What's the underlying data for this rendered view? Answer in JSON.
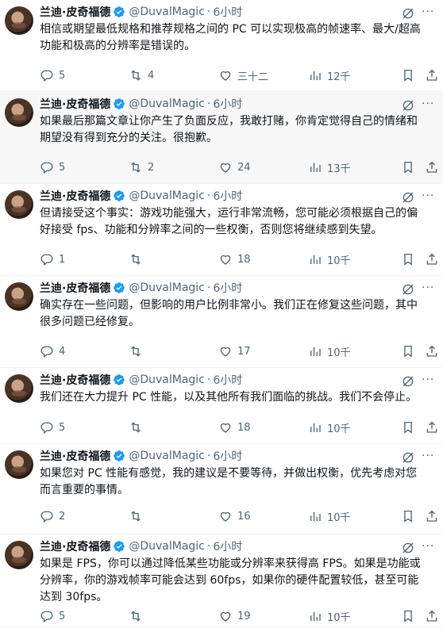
{
  "tweets": [
    {
      "name": "兰迪·皮奇福德",
      "handle": "@DuvalMagic",
      "dot": "·",
      "time": "6小时",
      "text": "相信或期望最低规格和推荐规格之间的 PC 可以实现极高的帧速率、最大/超高\n功能和极高的分辨率是错误的。",
      "replies": "5",
      "retweets": "4",
      "likes": "三十二",
      "views": "12千",
      "highlighted": false
    },
    {
      "name": "兰迪·皮奇福德",
      "handle": "@DuvalMagic",
      "dot": "·",
      "time": "6小时",
      "text": "如果最后那篇文章让你产生了负面反应，我敢打赌，你肯定觉得自己的情绪和\n期望没有得到充分的关注。很抱歉。",
      "replies": "5",
      "retweets": "2",
      "likes": "24",
      "views": "13千",
      "highlighted": true
    },
    {
      "name": "兰迪·皮奇福德",
      "handle": "@DuvalMagic",
      "dot": "·",
      "time": "6小时",
      "text": "但请接受这个事实：游戏功能强大，运行非常流畅，您可能必须根据自己的偏\n好接受 fps、功能和分辨率之间的一些权衡，否则您将继续感到失望。",
      "replies": "1",
      "retweets": "",
      "likes": "18",
      "views": "10千",
      "highlighted": false
    },
    {
      "name": "兰迪·皮奇福德",
      "handle": "@DuvalMagic",
      "dot": "·",
      "time": "6小时",
      "text": "确实存在一些问题，但影响的用户比例非常小。我们正在修复这些问题，其中\n很多问题已经修复。",
      "replies": "4",
      "retweets": "",
      "likes": "17",
      "views": "10千",
      "highlighted": false
    },
    {
      "name": "兰迪·皮奇福德",
      "handle": "@DuvalMagic",
      "dot": "·",
      "time": "6小时",
      "text": "我们还在大力提升 PC 性能，以及其他所有我们面临的挑战。我们不会停止。",
      "replies": "5",
      "retweets": "",
      "likes": "18",
      "views": "10千",
      "highlighted": false
    },
    {
      "name": "兰迪·皮奇福德",
      "handle": "@DuvalMagic",
      "dot": "·",
      "time": "6小时",
      "text": "如果您对 PC 性能有感觉，我的建议是不要等待，并做出权衡，优先考虑对您\n而言重要的事情。",
      "replies": "2",
      "retweets": "",
      "likes": "16",
      "views": "10千",
      "highlighted": false
    },
    {
      "name": "兰迪·皮奇福德",
      "handle": "@DuvalMagic",
      "dot": "·",
      "time": "6小时",
      "text": "如果是 FPS，你可以通过降低某些功能或分辨率来获得高 FPS。如果是功能或\n分辨率，你的游戏帧率可能会达到 60fps，如果你的硬件配置较低，甚至可能\n达到 30fps。",
      "replies": "5",
      "retweets": "",
      "likes": "19",
      "views": "10千",
      "highlighted": false
    }
  ],
  "colors": {
    "verified": "#1d9bf0",
    "muted": "#536471",
    "highlight_bg": "#f7f7f7"
  },
  "icons": [
    "verified-badge-icon",
    "grok-icon",
    "more-icon",
    "reply-icon",
    "retweet-icon",
    "like-icon",
    "views-icon",
    "bookmark-icon",
    "share-icon"
  ]
}
